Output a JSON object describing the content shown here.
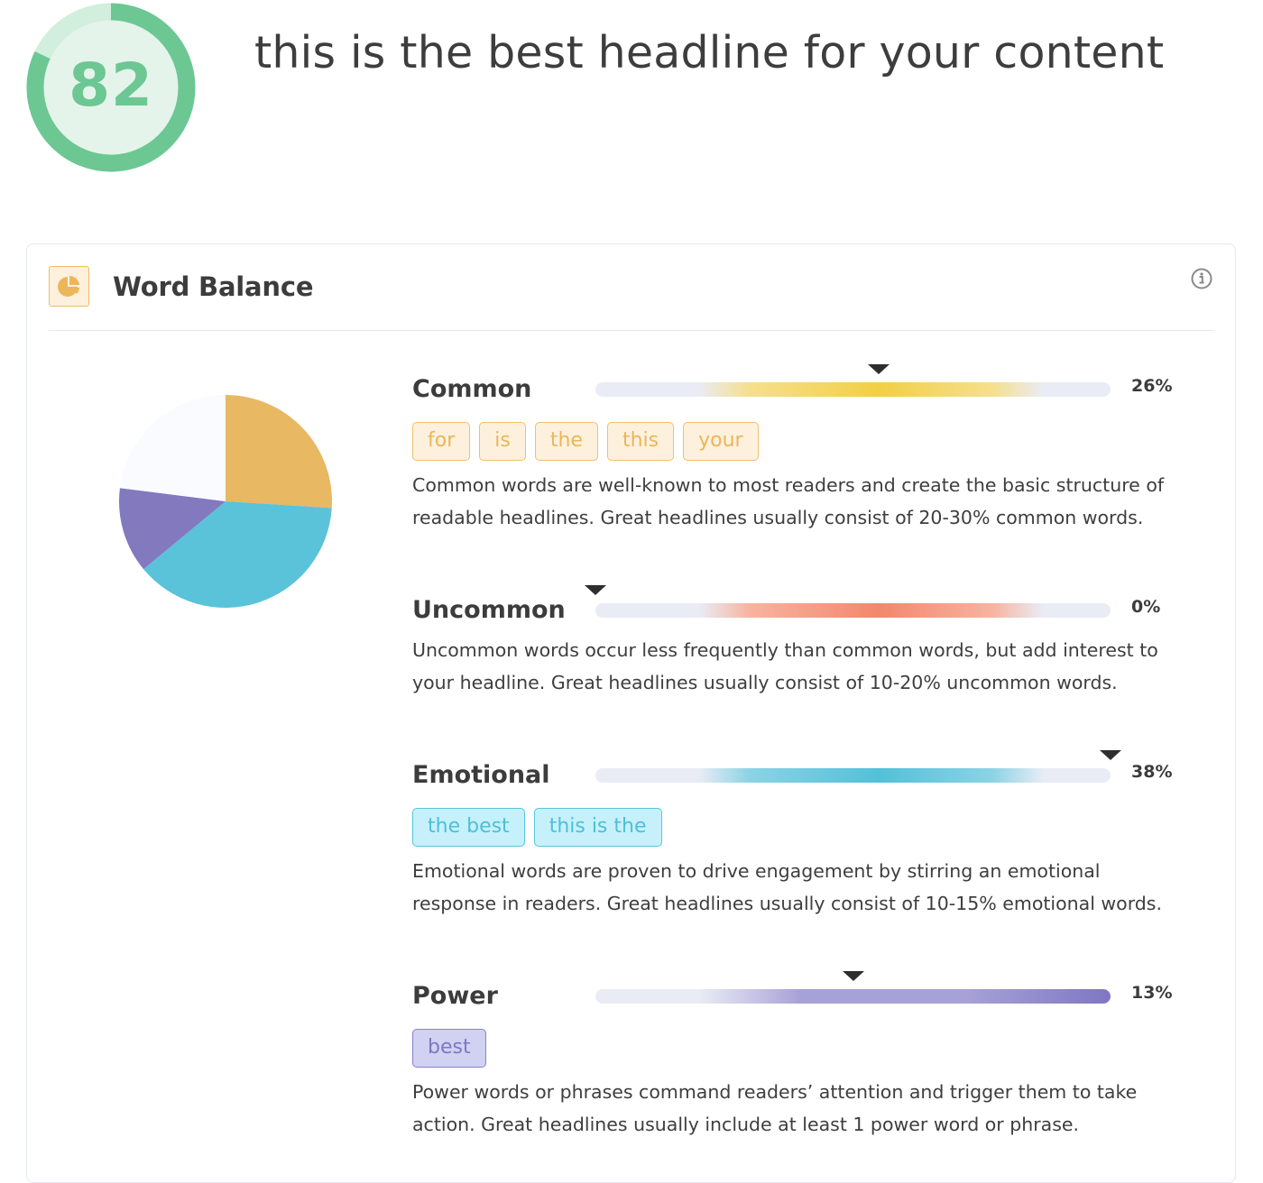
{
  "score": {
    "value": "82",
    "fraction": 0.82,
    "colors": {
      "progress": "#6cc793",
      "track": "#d2eedd",
      "fill": "#e4f4ea"
    }
  },
  "headline": "this is the best headline for your content",
  "card": {
    "title": "Word Balance",
    "icon": "pie-chart-icon",
    "info_icon": "info-icon"
  },
  "chart_data": {
    "type": "pie",
    "title": "Word Balance",
    "slices": [
      {
        "name": "Common",
        "value": 26,
        "color": "#e8b862"
      },
      {
        "name": "Emotional",
        "value": 38,
        "color": "#5ac3da"
      },
      {
        "name": "Power",
        "value": 13,
        "color": "#8279bf"
      },
      {
        "name": "Other",
        "value": 23,
        "color": "#fafbff"
      }
    ],
    "start": "top",
    "direction": "clockwise"
  },
  "sections": [
    {
      "key": "common",
      "title": "Common",
      "percent": "26%",
      "marker_fraction": 0.55,
      "gradient": [
        "#e9ecf5",
        "#f6df8c",
        "#f2cf45",
        "#f6df8c",
        "#e9ecf5"
      ],
      "chips": [
        "for",
        "is",
        "the",
        "this",
        "your"
      ],
      "description": [
        "Common words are well-known to most readers and create the basic structure of",
        "readable headlines. Great headlines usually consist of 20-30% common words."
      ]
    },
    {
      "key": "uncommon",
      "title": "Uncommon",
      "percent": "0%",
      "marker_fraction": 0.0,
      "gradient": [
        "#e9ecf5",
        "#f7b3a0",
        "#f2886c",
        "#f7b3a0",
        "#e9ecf5"
      ],
      "chips": [],
      "description": [
        "Uncommon words occur less frequently than common words, but add interest to",
        "your headline. Great headlines usually consist of 10-20% uncommon words."
      ]
    },
    {
      "key": "emotional",
      "title": "Emotional",
      "percent": "38%",
      "marker_fraction": 1.0,
      "gradient": [
        "#e9ecf5",
        "#8bd3e5",
        "#53c0d9",
        "#8bd3e5",
        "#e9ecf5"
      ],
      "chips": [
        "the best",
        "this is the"
      ],
      "description": [
        "Emotional words are proven to drive engagement by stirring an emotional",
        "response in readers. Great headlines usually consist of 10-15% emotional words."
      ]
    },
    {
      "key": "power",
      "title": "Power",
      "percent": "13%",
      "marker_fraction": 0.5,
      "gradient": [
        "#e9ecf5",
        "#c3c0e4",
        "#a6a1d6",
        "#a6a1d6",
        "#7f77c3"
      ],
      "chips": [
        "best"
      ],
      "description": [
        "Power words or phrases command readers’ attention and trigger them to take",
        "action. Great headlines usually include at least 1 power word or phrase."
      ]
    }
  ]
}
